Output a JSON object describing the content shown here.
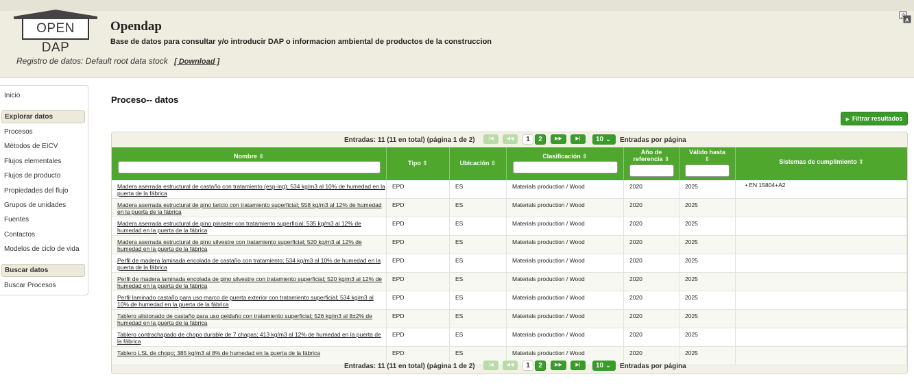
{
  "header": {
    "logo_text": "OPEN DAP",
    "title": "Opendap",
    "subtitle": "Base de datos para consultar y/o introducir DAP o informacion ambiental de productos de la construccion",
    "registry_label": "Registro de datos: Default root data stock",
    "download_link": "[ Download ]",
    "language_icon": "translate-icon"
  },
  "sidebar": {
    "home": "Inicio",
    "explore_heading": "Explorar datos",
    "explore_items": [
      "Procesos",
      "Métodos de EICV",
      "Flujos elementales",
      "Flujos de producto",
      "Propiedades del flujo",
      "Grupos de unidades",
      "Fuentes",
      "Contactos",
      "Modelos de ciclo de vida"
    ],
    "search_heading": "Buscar datos",
    "search_items": [
      "Buscar Procesos"
    ]
  },
  "main": {
    "page_title": "Proceso-- datos",
    "filter_button": "Filtrar resultados"
  },
  "pager": {
    "info": "Entradas: 11 (11 en total) (página 1 de 2)",
    "pages": [
      "1",
      "2"
    ],
    "current_page": "1",
    "per_page": "10",
    "per_page_label": "Entradas por página",
    "first_icon": "first-page-icon",
    "prev_icon": "previous-page-icon",
    "next_icon": "next-page-icon",
    "last_icon": "last-page-icon"
  },
  "table": {
    "columns": [
      "Nombre",
      "Tipo",
      "Ubicación",
      "Clasificación",
      "Año de referencia",
      "Válido hasta",
      "Sistemas de cumplimiento"
    ],
    "rows": [
      {
        "name": "Madera aserrada estructural de castaño con tratamiento (esp-ing); 534 kg/m3 al 10% de humedad en la puerta de la fábrica",
        "type": "EPD",
        "location": "ES",
        "classification": "Materials production / Wood",
        "ref_year": "2020",
        "valid_until": "2025",
        "compliance": "• EN 15804+A2"
      },
      {
        "name": "Madera aserrada estructural de pino laricio con tratamiento superficial; 558 kg/m3 al 12% de humedad en la puerta de la fábrica",
        "type": "EPD",
        "location": "ES",
        "classification": "Materials production / Wood",
        "ref_year": "2020",
        "valid_until": "2025",
        "compliance": ""
      },
      {
        "name": "Madera aserrada estructural de pino pinaster con tratamiento superficial; 535 kg/m3 al 12% de humedad en la puerta de la fábrica",
        "type": "EPD",
        "location": "ES",
        "classification": "Materials production / Wood",
        "ref_year": "2020",
        "valid_until": "2025",
        "compliance": ""
      },
      {
        "name": "Madera aserrada estructural de pino silvestre con tratamiento superficial; 520 kg/m3 al 12% de humedad en la puerta de la fábrica",
        "type": "EPD",
        "location": "ES",
        "classification": "Materials production / Wood",
        "ref_year": "2020",
        "valid_until": "2025",
        "compliance": ""
      },
      {
        "name": "Perfil de madera laminada encolada de castaño con tratamiento; 534 kg/m3 al 10% de humedad en la puerta de la fábrica",
        "type": "EPD",
        "location": "ES",
        "classification": "Materials production / Wood",
        "ref_year": "2020",
        "valid_until": "2025",
        "compliance": ""
      },
      {
        "name": "Perfil de madera laminada encolada de pino silvestre con tratamiento superficial; 520 kg/m3 al 12% de humedad en la puerta de la fábrica",
        "type": "EPD",
        "location": "ES",
        "classification": "Materials production / Wood",
        "ref_year": "2020",
        "valid_until": "2025",
        "compliance": ""
      },
      {
        "name": "Perfil laminado castaño para uso marco de puerta exterior con tratamiento superficial; 534 kg/m3 al 10% de humedad en la puerta de la fábrica",
        "type": "EPD",
        "location": "ES",
        "classification": "Materials production / Wood",
        "ref_year": "2020",
        "valid_until": "2025",
        "compliance": ""
      },
      {
        "name": "Tablero alistonado de castaño para uso peldaño con tratamiento superficial; 526 kg/m3 al 8±2% de humedad en la puerta de la fábrica",
        "type": "EPD",
        "location": "ES",
        "classification": "Materials production / Wood",
        "ref_year": "2020",
        "valid_until": "2025",
        "compliance": ""
      },
      {
        "name": "Tablero contrachapado de chopo durable de 7 chapas; 413 kg/m3 al 12% de humedad en la puerta de la fábrica",
        "type": "EPD",
        "location": "ES",
        "classification": "Materials production / Wood",
        "ref_year": "2020",
        "valid_until": "2025",
        "compliance": ""
      },
      {
        "name": "Tablero LSL de chopo; 385 kg/m3 al 8% de humedad en la puerta de la fábrica",
        "type": "EPD",
        "location": "ES",
        "classification": "Materials production / Wood",
        "ref_year": "2020",
        "valid_until": "2025",
        "compliance": ""
      }
    ]
  },
  "colors": {
    "header_bg": "#efeddf",
    "accent_green": "#4fa72e",
    "button_green": "#3a9a2a"
  }
}
